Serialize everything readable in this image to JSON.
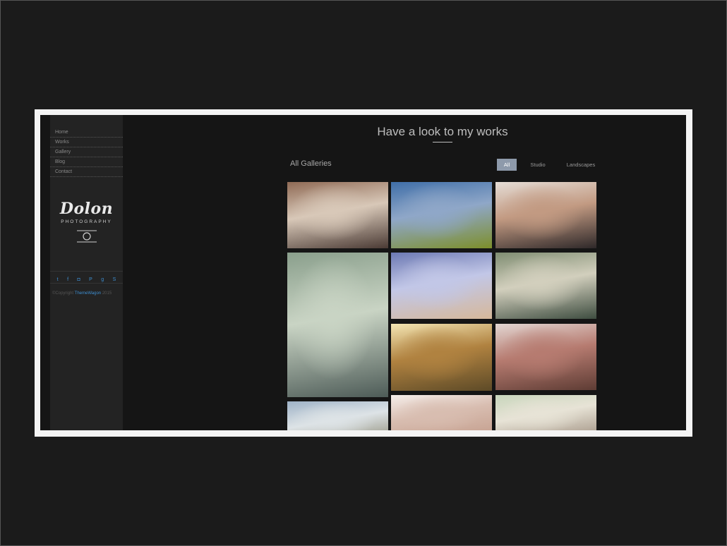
{
  "sidebar": {
    "nav": [
      "Home",
      "Works",
      "Gallery",
      "Blog",
      "Contact"
    ],
    "logo": {
      "name": "Dolon",
      "tagline": "PHOTOGRAPHY"
    },
    "social_icons": [
      "twitter-icon",
      "facebook-icon",
      "instagram-icon",
      "pinterest-icon",
      "google-plus-icon",
      "skype-icon"
    ],
    "copyright": {
      "prefix": "©Copyright",
      "brand": "ThemeWagon",
      "year": "2015"
    }
  },
  "main": {
    "headline": "Have a look to my works",
    "galleries_label": "All Galleries",
    "filters": [
      {
        "label": "All",
        "active": true
      },
      {
        "label": "Studio",
        "active": false
      },
      {
        "label": "Landscapes",
        "active": false
      }
    ],
    "gallery": [
      {
        "subject": "woman in car",
        "colors": [
          "#8f6a55",
          "#d8c8b8",
          "#4a3a34"
        ]
      },
      {
        "subject": "sunflower field",
        "colors": [
          "#3f6ea8",
          "#8fa7c8",
          "#7d8f2a"
        ]
      },
      {
        "subject": "woman in car legs up",
        "colors": [
          "#e5ddd6",
          "#c29a82",
          "#2e2829"
        ]
      },
      {
        "subject": "woman in hammock",
        "colors": [
          "#8a9f8c",
          "#c9d4c4",
          "#4d5b57"
        ]
      },
      {
        "subject": "balcony and palm tree",
        "colors": [
          "#6c79b3",
          "#c2c7e7",
          "#d6b89a"
        ]
      },
      {
        "subject": "mountain river",
        "colors": [
          "#7f8d72",
          "#d2cfbd",
          "#3e4d40"
        ]
      },
      {
        "subject": "sunlit hills",
        "colors": [
          "#f4e6b4",
          "#b08240",
          "#5d4a27"
        ]
      },
      {
        "subject": "woman with hands raised",
        "colors": [
          "#e3d7d3",
          "#b67b70",
          "#5e3c34"
        ]
      },
      {
        "subject": "cloudy landscape",
        "colors": [
          "#9eb2c7",
          "#dde3e6",
          "#8b8872"
        ]
      },
      {
        "subject": "woman portrait bright",
        "colors": [
          "#f5eeea",
          "#d8bdb0",
          "#c49e8d"
        ]
      },
      {
        "subject": "woman outdoors",
        "colors": [
          "#c8d6bc",
          "#e7e3d6",
          "#a49586"
        ]
      }
    ]
  },
  "colors": {
    "accent": "#3e8ed0",
    "filter_active": "#8e9aab"
  }
}
